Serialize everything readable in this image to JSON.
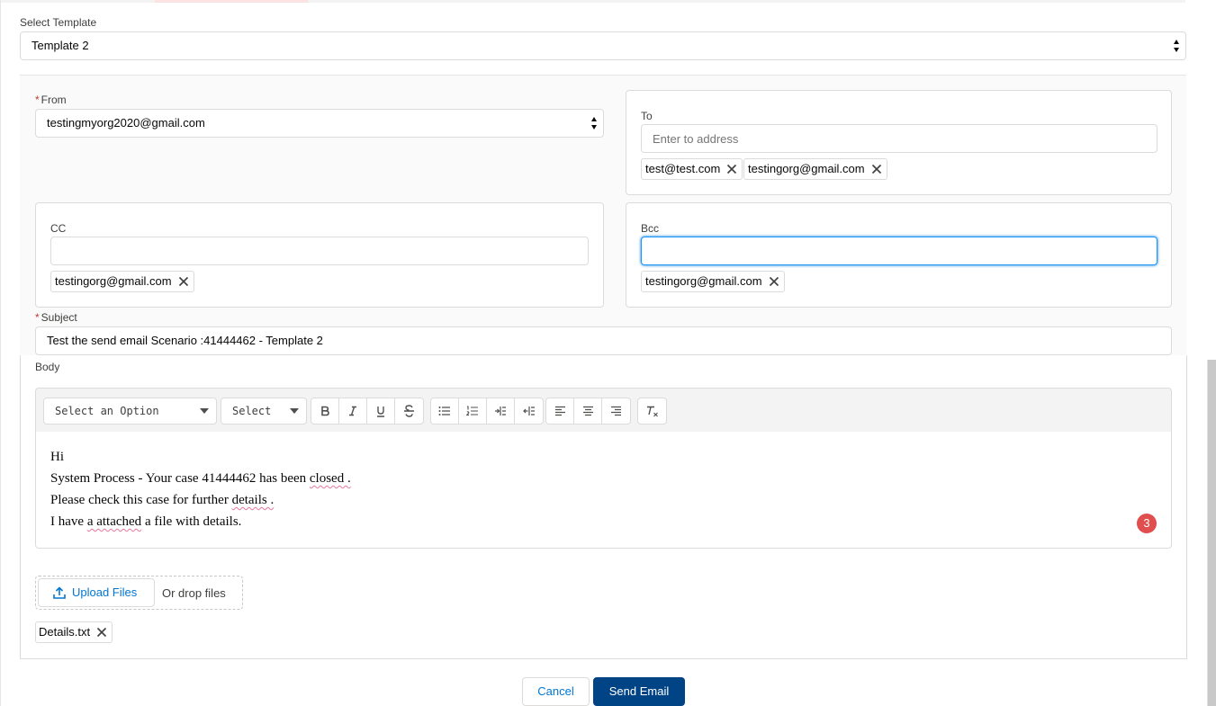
{
  "template": {
    "label": "Select Template",
    "value": "Template 2"
  },
  "from": {
    "label": "From",
    "value": "testingmyorg2020@gmail.com"
  },
  "to": {
    "label": "To",
    "placeholder": "Enter to address",
    "pills": [
      "test@test.com",
      "testingorg@gmail.com"
    ]
  },
  "cc": {
    "label": "CC",
    "pills": [
      "testingorg@gmail.com"
    ]
  },
  "bcc": {
    "label": "Bcc",
    "pills": [
      "testingorg@gmail.com"
    ]
  },
  "subject": {
    "label": "Subject",
    "value": "Test the send email Scenario :41444462 - Template 2"
  },
  "body": {
    "label": "Body",
    "toolbar": {
      "font_select": "Select an Option",
      "size_select": "Select"
    },
    "lines": {
      "l1": "Hi",
      "l2_a": "System Process - Your case 41444462 has been ",
      "l2_b": "closed .",
      "l3_a": "Please check this case for further ",
      "l3_b": "details .",
      "l4_a": "I have ",
      "l4_b": "a attached",
      "l4_c": " a file with details."
    },
    "badge_count": "3"
  },
  "upload": {
    "button_label": "Upload Files",
    "drop_text": "Or drop files",
    "files": [
      "Details.txt"
    ]
  },
  "actions": {
    "cancel": "Cancel",
    "send": "Send Email"
  }
}
